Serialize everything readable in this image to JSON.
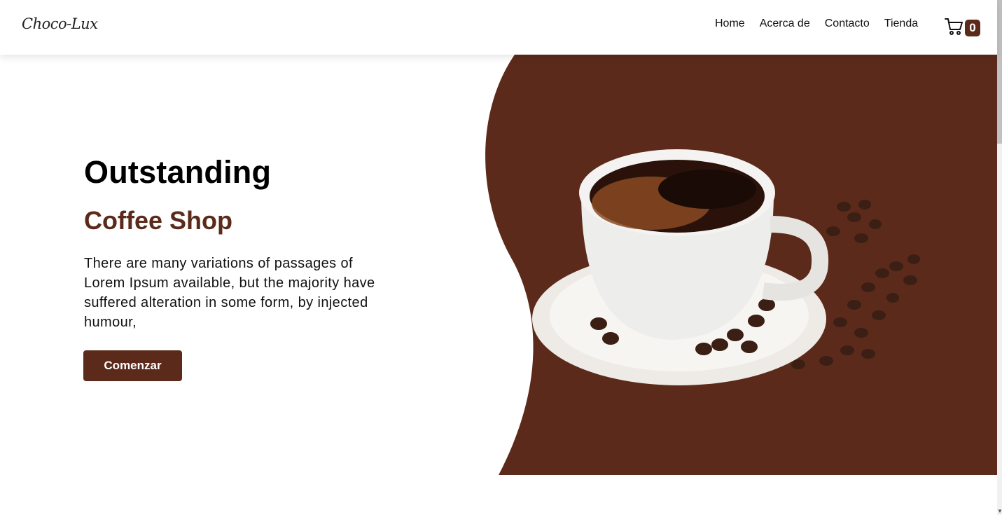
{
  "header": {
    "brand": "Choco-Lux",
    "nav": [
      {
        "label": "Home"
      },
      {
        "label": "Acerca de"
      },
      {
        "label": "Contacto"
      },
      {
        "label": "Tienda"
      }
    ],
    "cart_count": "0",
    "cart_icon": "shopping-cart-icon"
  },
  "hero": {
    "title": "Outstanding",
    "subtitle": "Coffee Shop",
    "description": "There are many variations of passages of Lorem Ipsum available, but the majority have suffered alteration in some form, by injected humour,",
    "cta_label": "Comenzar",
    "image": "coffee-cup-with-beans"
  },
  "colors": {
    "accent": "#5b2a1a",
    "background": "#ffffff",
    "text": "#111111"
  }
}
